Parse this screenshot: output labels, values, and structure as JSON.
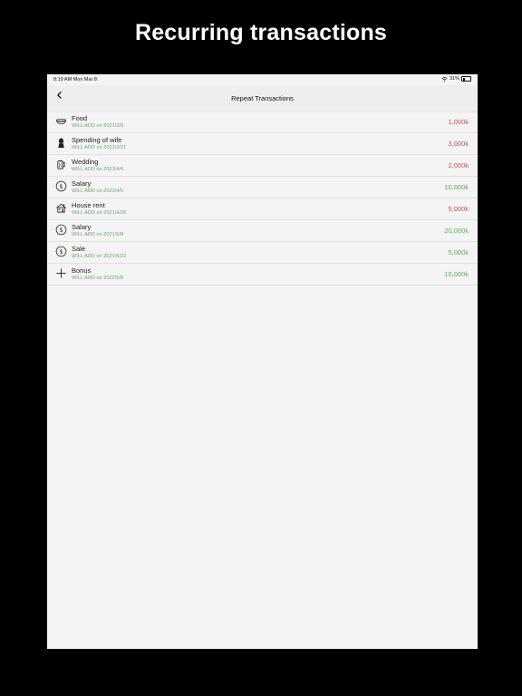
{
  "headline": "Recurring transactions",
  "status_bar": {
    "time": "8:19 AM   Mon Mar 8",
    "battery": "31%"
  },
  "nav": {
    "title": "Repeat Transactions"
  },
  "transactions": [
    {
      "title": "Food",
      "subtitle": "WILL ADD on 2021/3/9",
      "amount": "1,000k",
      "type": "expense",
      "icon": "bowl-icon"
    },
    {
      "title": "Spending of wife",
      "subtitle": "WILL ADD on 2021/3/21",
      "amount": "3,000k",
      "type": "expense",
      "icon": "woman-icon"
    },
    {
      "title": "Wedding",
      "subtitle": "WILL ADD on 2021/4/4",
      "amount": "2,000k",
      "type": "expense",
      "icon": "beer-mug-icon"
    },
    {
      "title": "Salary",
      "subtitle": "WILL ADD on 2021/4/5",
      "amount": "10,000k",
      "type": "income",
      "icon": "dollar-coin-icon"
    },
    {
      "title": "House rent",
      "subtitle": "WILL ADD on 2021/4/26",
      "amount": "5,000k",
      "type": "expense",
      "icon": "house-icon"
    },
    {
      "title": "Salary",
      "subtitle": "WILL ADD on 2021/5/8",
      "amount": "20,000k",
      "type": "income",
      "icon": "dollar-coin-icon"
    },
    {
      "title": "Sale",
      "subtitle": "WILL ADD on 2021/6/22",
      "amount": "5,000k",
      "type": "income",
      "icon": "dollar-coin-icon"
    },
    {
      "title": "Bonus",
      "subtitle": "WILL ADD on 2022/5/8",
      "amount": "10,000k",
      "type": "income",
      "icon": "plus-icon"
    }
  ],
  "colors": {
    "expense": "#d0534a",
    "income": "#5bb15a",
    "subtitle": "#6aaa64"
  }
}
